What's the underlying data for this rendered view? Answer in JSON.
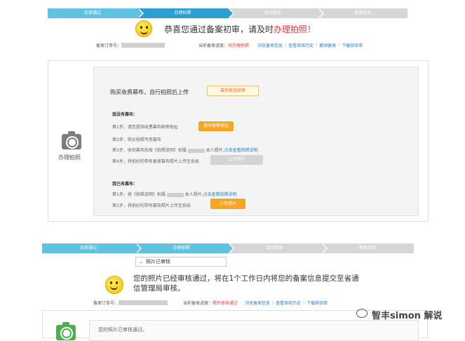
{
  "top": {
    "steps": [
      "初审通过",
      "办理拍照",
      "提交管局",
      "备案完成"
    ],
    "headline_prefix": "恭喜您通过备案初审，请及时",
    "headline_emphasis": "办理拍照！",
    "order_label": "备案订单号：",
    "progress_label": "当前备案进度：",
    "progress_value": "待办理拍照",
    "links": [
      "浏览备案信息",
      "查看审核历史",
      "撤销备案",
      "下载核验单"
    ]
  },
  "panel": {
    "side_label": "办理拍照",
    "buy_text": "购买收费幕布，自行拍照后上传",
    "notice_tag": "幕布寄送邮寄",
    "no_curtain_title": "我没有幕布：",
    "no_curtain_steps": [
      {
        "no": "第1步，",
        "text": "请您提供收费幕布邮寄地址"
      },
      {
        "no": "第2步，",
        "text": "购买拍照专用幕布"
      },
      {
        "no": "第3步，",
        "text": "收到幕布后按《拍照说明》拍摄",
        "suffix": "本人照片,",
        "link": "点击查看拍照说明"
      },
      {
        "no": "第4步，",
        "text": "将拍好的带有备案幕布照片上传至系统"
      }
    ],
    "btn_address": "填写邮寄地址",
    "btn_upload_disabled": "上传照片",
    "have_curtain_title": "我已有幕布：",
    "have_curtain_steps": [
      {
        "no": "第1步，",
        "text": "按《拍照说明》拍摄",
        "suffix": "本人照片,",
        "link": "点击查看拍照说明"
      },
      {
        "no": "第2步，",
        "text": "将拍好的带有幕布照片上传至系统"
      }
    ],
    "btn_upload": "上传照片"
  },
  "bottom": {
    "steps": [
      "初审通过",
      "办理拍照",
      "提交管局",
      "备案完成"
    ],
    "photo_status": "照片已审核",
    "message": "您的照片已经审核通过，将在1个工作日内将您的备案信息提交至省通信管理局审核。",
    "order_label": "备案订单号：",
    "progress_label": "当前备案进度：",
    "progress_value": "照片审核通过",
    "links": [
      "浏览备案信息",
      "查看审核历史",
      "下载核验单"
    ],
    "panel_text": "您的照片已审核通过。"
  },
  "watermark": "智丰simon 解说",
  "colors": {
    "active_step": "#2a9fd0",
    "done_step": "#5fc3e0",
    "accent_red": "#e53935",
    "orange": "#f5a623",
    "link": "#2a7fc8"
  }
}
